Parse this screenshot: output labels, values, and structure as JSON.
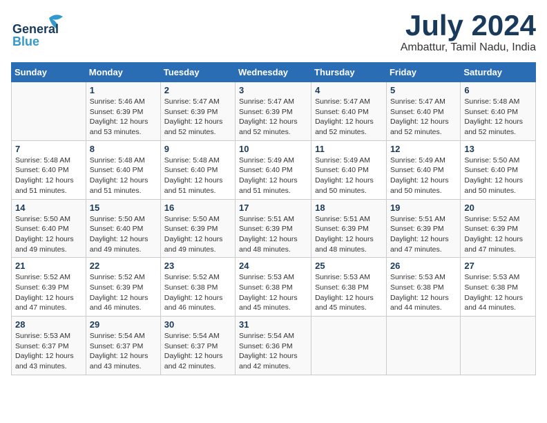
{
  "header": {
    "logo_line1": "General",
    "logo_line2": "Blue",
    "month": "July 2024",
    "location": "Ambattur, Tamil Nadu, India"
  },
  "columns": [
    "Sunday",
    "Monday",
    "Tuesday",
    "Wednesday",
    "Thursday",
    "Friday",
    "Saturday"
  ],
  "weeks": [
    [
      {
        "day": "",
        "info": ""
      },
      {
        "day": "1",
        "info": "Sunrise: 5:46 AM\nSunset: 6:39 PM\nDaylight: 12 hours\nand 53 minutes."
      },
      {
        "day": "2",
        "info": "Sunrise: 5:47 AM\nSunset: 6:39 PM\nDaylight: 12 hours\nand 52 minutes."
      },
      {
        "day": "3",
        "info": "Sunrise: 5:47 AM\nSunset: 6:39 PM\nDaylight: 12 hours\nand 52 minutes."
      },
      {
        "day": "4",
        "info": "Sunrise: 5:47 AM\nSunset: 6:40 PM\nDaylight: 12 hours\nand 52 minutes."
      },
      {
        "day": "5",
        "info": "Sunrise: 5:47 AM\nSunset: 6:40 PM\nDaylight: 12 hours\nand 52 minutes."
      },
      {
        "day": "6",
        "info": "Sunrise: 5:48 AM\nSunset: 6:40 PM\nDaylight: 12 hours\nand 52 minutes."
      }
    ],
    [
      {
        "day": "7",
        "info": "Sunrise: 5:48 AM\nSunset: 6:40 PM\nDaylight: 12 hours\nand 51 minutes."
      },
      {
        "day": "8",
        "info": "Sunrise: 5:48 AM\nSunset: 6:40 PM\nDaylight: 12 hours\nand 51 minutes."
      },
      {
        "day": "9",
        "info": "Sunrise: 5:48 AM\nSunset: 6:40 PM\nDaylight: 12 hours\nand 51 minutes."
      },
      {
        "day": "10",
        "info": "Sunrise: 5:49 AM\nSunset: 6:40 PM\nDaylight: 12 hours\nand 51 minutes."
      },
      {
        "day": "11",
        "info": "Sunrise: 5:49 AM\nSunset: 6:40 PM\nDaylight: 12 hours\nand 50 minutes."
      },
      {
        "day": "12",
        "info": "Sunrise: 5:49 AM\nSunset: 6:40 PM\nDaylight: 12 hours\nand 50 minutes."
      },
      {
        "day": "13",
        "info": "Sunrise: 5:50 AM\nSunset: 6:40 PM\nDaylight: 12 hours\nand 50 minutes."
      }
    ],
    [
      {
        "day": "14",
        "info": "Sunrise: 5:50 AM\nSunset: 6:40 PM\nDaylight: 12 hours\nand 49 minutes."
      },
      {
        "day": "15",
        "info": "Sunrise: 5:50 AM\nSunset: 6:40 PM\nDaylight: 12 hours\nand 49 minutes."
      },
      {
        "day": "16",
        "info": "Sunrise: 5:50 AM\nSunset: 6:39 PM\nDaylight: 12 hours\nand 49 minutes."
      },
      {
        "day": "17",
        "info": "Sunrise: 5:51 AM\nSunset: 6:39 PM\nDaylight: 12 hours\nand 48 minutes."
      },
      {
        "day": "18",
        "info": "Sunrise: 5:51 AM\nSunset: 6:39 PM\nDaylight: 12 hours\nand 48 minutes."
      },
      {
        "day": "19",
        "info": "Sunrise: 5:51 AM\nSunset: 6:39 PM\nDaylight: 12 hours\nand 47 minutes."
      },
      {
        "day": "20",
        "info": "Sunrise: 5:52 AM\nSunset: 6:39 PM\nDaylight: 12 hours\nand 47 minutes."
      }
    ],
    [
      {
        "day": "21",
        "info": "Sunrise: 5:52 AM\nSunset: 6:39 PM\nDaylight: 12 hours\nand 47 minutes."
      },
      {
        "day": "22",
        "info": "Sunrise: 5:52 AM\nSunset: 6:39 PM\nDaylight: 12 hours\nand 46 minutes."
      },
      {
        "day": "23",
        "info": "Sunrise: 5:52 AM\nSunset: 6:38 PM\nDaylight: 12 hours\nand 46 minutes."
      },
      {
        "day": "24",
        "info": "Sunrise: 5:53 AM\nSunset: 6:38 PM\nDaylight: 12 hours\nand 45 minutes."
      },
      {
        "day": "25",
        "info": "Sunrise: 5:53 AM\nSunset: 6:38 PM\nDaylight: 12 hours\nand 45 minutes."
      },
      {
        "day": "26",
        "info": "Sunrise: 5:53 AM\nSunset: 6:38 PM\nDaylight: 12 hours\nand 44 minutes."
      },
      {
        "day": "27",
        "info": "Sunrise: 5:53 AM\nSunset: 6:38 PM\nDaylight: 12 hours\nand 44 minutes."
      }
    ],
    [
      {
        "day": "28",
        "info": "Sunrise: 5:53 AM\nSunset: 6:37 PM\nDaylight: 12 hours\nand 43 minutes."
      },
      {
        "day": "29",
        "info": "Sunrise: 5:54 AM\nSunset: 6:37 PM\nDaylight: 12 hours\nand 43 minutes."
      },
      {
        "day": "30",
        "info": "Sunrise: 5:54 AM\nSunset: 6:37 PM\nDaylight: 12 hours\nand 42 minutes."
      },
      {
        "day": "31",
        "info": "Sunrise: 5:54 AM\nSunset: 6:36 PM\nDaylight: 12 hours\nand 42 minutes."
      },
      {
        "day": "",
        "info": ""
      },
      {
        "day": "",
        "info": ""
      },
      {
        "day": "",
        "info": ""
      }
    ]
  ]
}
